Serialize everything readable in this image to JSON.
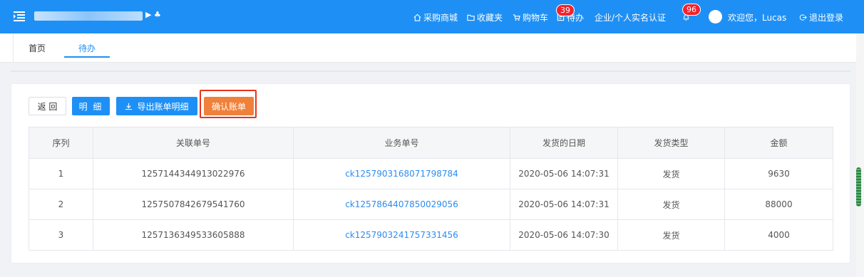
{
  "header": {
    "logo_glyphs": "▶ ♣",
    "nav": [
      {
        "label": "采购商城",
        "icon": "house-icon"
      },
      {
        "label": "收藏夹",
        "icon": "folder-icon"
      },
      {
        "label": "购物车",
        "icon": "cart-icon"
      },
      {
        "label": "待办",
        "icon": "todo-icon",
        "badge": "39"
      },
      {
        "label": "企业/个人实名认证"
      },
      {
        "label": "",
        "icon": "bell-icon",
        "badge": "96"
      }
    ],
    "welcome": "欢迎您，Lucas",
    "logout": "退出登录"
  },
  "tabs": [
    {
      "label": "首页",
      "active": false
    },
    {
      "label": "待办",
      "active": true
    }
  ],
  "toolbar": {
    "back_label": "返 回",
    "detail_label": "明 细",
    "export_label": "导出账单明细",
    "confirm_label": "确认账单"
  },
  "table": {
    "columns": [
      "序列",
      "关联单号",
      "业务单号",
      "发货的日期",
      "发货类型",
      "金额"
    ],
    "rows": [
      [
        "1",
        "1257144344913022976",
        "ck1257903168071798784",
        "2020-05-06 14:07:31",
        "发货",
        "9630"
      ],
      [
        "2",
        "1257507842679541760",
        "ck1257864407850029056",
        "2020-05-06 14:07:31",
        "发货",
        "88000"
      ],
      [
        "3",
        "1257136349533605888",
        "ck1257903241757331456",
        "2020-05-06 14:07:30",
        "发货",
        "4000"
      ]
    ]
  },
  "colors": {
    "header_bg": "#1e90f5",
    "primary": "#1e90f5",
    "confirm": "#f0813a",
    "highlight_outline": "#e8341c",
    "link": "#2d8cf0",
    "badge": "#f5222d"
  }
}
